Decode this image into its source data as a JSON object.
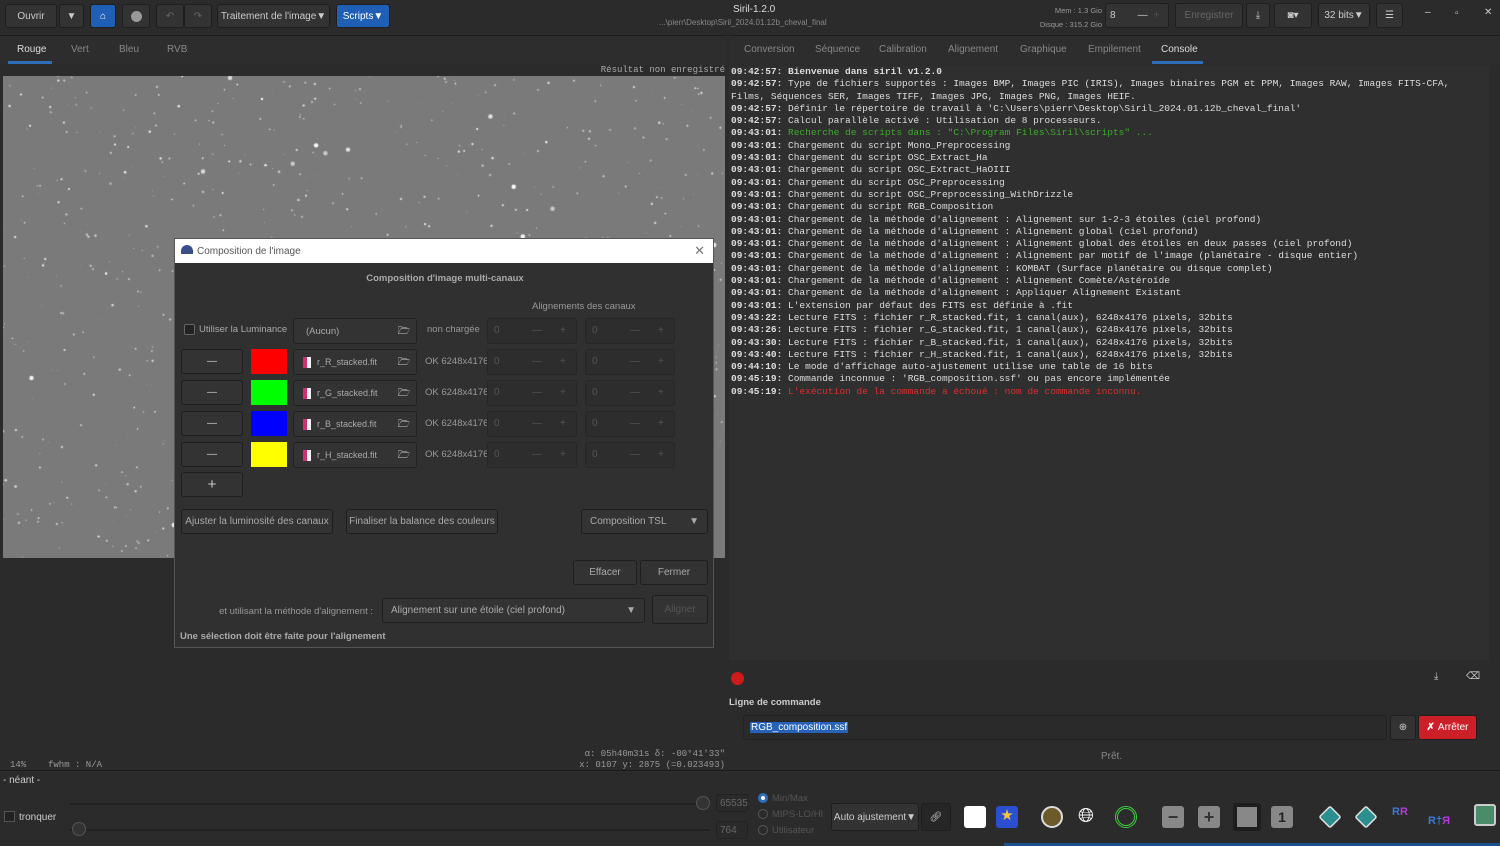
{
  "titlebar": {
    "app_title": "Siril-1.2.0",
    "path": "...\\pierr\\Desktop\\Siril_2024.01.12b_cheval_final",
    "mem": "Mem : 1.3 Gio",
    "disk": "Disque : 315.2 Gio",
    "threads": "8",
    "save": "Enregistrer",
    "bits": "32 bits"
  },
  "toolbar": {
    "open": "Ouvrir",
    "image_processing": "Traitement de l'image",
    "scripts": "Scripts"
  },
  "left_tabs": [
    "Rouge",
    "Vert",
    "Bleu",
    "RVB"
  ],
  "right_tabs": [
    "Conversion",
    "Séquence",
    "Calibration",
    "Alignement",
    "Graphique",
    "Empilement",
    "Console"
  ],
  "image": {
    "unsaved": "Résultat non enregistré",
    "zoom": "14%",
    "fwhm": "fwhm : N/A",
    "coords1": "α: 05h40m31s δ: -00°41'33\"",
    "coords2": "x: 0107 y: 2875 (=0.023493)"
  },
  "console": [
    {
      "t": "09:42:57:",
      "m": "Bienvenue dans siril v1.2.0",
      "c": "bold"
    },
    {
      "t": "09:42:57:",
      "m": "Type de fichiers supportés : Images BMP, Images PIC (IRIS), Images binaires PGM et PPM, Images RAW, Images FITS-CFA, Films, Séquences SER, Images TIFF, Images JPG, Images PNG, Images HEIF.",
      "c": ""
    },
    {
      "t": "09:42:57:",
      "m": "Définir le répertoire de travail à 'C:\\Users\\pierr\\Desktop\\Siril_2024.01.12b_cheval_final'",
      "c": ""
    },
    {
      "t": "09:42:57:",
      "m": "Calcul parallèle activé : Utilisation de 8 processeurs.",
      "c": ""
    },
    {
      "t": "09:43:01:",
      "m": "Recherche de scripts dans : \"C:\\Program Files\\Siril\\scripts\" ...",
      "c": "green"
    },
    {
      "t": "09:43:01:",
      "m": "Chargement du script Mono_Preprocessing",
      "c": ""
    },
    {
      "t": "09:43:01:",
      "m": "Chargement du script OSC_Extract_Ha",
      "c": ""
    },
    {
      "t": "09:43:01:",
      "m": "Chargement du script OSC_Extract_HaOIII",
      "c": ""
    },
    {
      "t": "09:43:01:",
      "m": "Chargement du script OSC_Preprocessing",
      "c": ""
    },
    {
      "t": "09:43:01:",
      "m": "Chargement du script OSC_Preprocessing_WithDrizzle",
      "c": ""
    },
    {
      "t": "09:43:01:",
      "m": "Chargement du script RGB_Composition",
      "c": ""
    },
    {
      "t": "09:43:01:",
      "m": "Chargement de la méthode d'alignement : Alignement sur 1-2-3 étoiles (ciel profond)",
      "c": ""
    },
    {
      "t": "09:43:01:",
      "m": "Chargement de la méthode d'alignement : Alignement global (ciel profond)",
      "c": ""
    },
    {
      "t": "09:43:01:",
      "m": "Chargement de la méthode d'alignement : Alignement global des étoiles en deux passes (ciel profond)",
      "c": ""
    },
    {
      "t": "09:43:01:",
      "m": "Chargement de la méthode d'alignement : Alignement par motif de l'image (planétaire - disque entier)",
      "c": ""
    },
    {
      "t": "09:43:01:",
      "m": "Chargement de la méthode d'alignement : KOMBAT (Surface planétaire ou disque complet)",
      "c": ""
    },
    {
      "t": "09:43:01:",
      "m": "Chargement de la méthode d'alignement : Alignement Comète/Astéroïde",
      "c": ""
    },
    {
      "t": "09:43:01:",
      "m": "Chargement de la méthode d'alignement : Appliquer Alignement Existant",
      "c": ""
    },
    {
      "t": "09:43:01:",
      "m": "L'extension par défaut des FITS est définie à .fit",
      "c": ""
    },
    {
      "t": "09:43:22:",
      "m": "Lecture FITS : fichier r_R_stacked.fit, 1 canal(aux), 6248x4176 pixels, 32bits",
      "c": ""
    },
    {
      "t": "09:43:26:",
      "m": "Lecture FITS : fichier r_G_stacked.fit, 1 canal(aux), 6248x4176 pixels, 32bits",
      "c": ""
    },
    {
      "t": "09:43:30:",
      "m": "Lecture FITS : fichier r_B_stacked.fit, 1 canal(aux), 6248x4176 pixels, 32bits",
      "c": ""
    },
    {
      "t": "09:43:40:",
      "m": "Lecture FITS : fichier r_H_stacked.fit, 1 canal(aux), 6248x4176 pixels, 32bits",
      "c": ""
    },
    {
      "t": "09:44:10:",
      "m": "Le mode d'affichage auto-ajustement utilise une table de 16 bits",
      "c": ""
    },
    {
      "t": "09:45:19:",
      "m": "Commande inconnue : 'RGB_composition.ssf' ou pas encore implémentée",
      "c": ""
    },
    {
      "t": "09:45:19:",
      "m": "L'exécution de la commande a échoué : nom de commande inconnu.",
      "c": "red"
    }
  ],
  "command": {
    "label": "Ligne de commande",
    "value": "RGB_composition.ssf",
    "stop": "Arrêter",
    "status": "Prêt."
  },
  "dialog": {
    "title": "Composition de l'image",
    "heading": "Composition d'image multi-canaux",
    "align_header": "Alignements des canaux",
    "luminance": {
      "label": "Utiliser la Luminance",
      "file": "(Aucun)",
      "status": "non chargée"
    },
    "channels": [
      {
        "color": "#ff0000",
        "file": "r_R_stacked.fit",
        "status": "OK 6248x4176"
      },
      {
        "color": "#00ff00",
        "file": "r_G_stacked.fit",
        "status": "OK 6248x4176"
      },
      {
        "color": "#0000ff",
        "file": "r_B_stacked.fit",
        "status": "OK 6248x4176"
      },
      {
        "color": "#ffff00",
        "file": "r_H_stacked.fit",
        "status": "OK 6248x4176"
      }
    ],
    "spin_value": "0",
    "adjust": "Ajuster la luminosité des canaux",
    "finalize": "Finaliser la balance des couleurs",
    "mode": "Composition TSL",
    "clear": "Effacer",
    "close": "Fermer",
    "method_label": "et utilisant la méthode d'alignement :",
    "method": "Alignement sur une étoile (ciel profond)",
    "align": "Aligner",
    "hint": "Une sélection doit être faite pour l'alignement"
  },
  "bottom": {
    "none": "- néant -",
    "clip": "tronquer",
    "high": "65535",
    "low": "764",
    "radios": [
      "Min/Max",
      "MIPS-LO/HI",
      "Utilisateur"
    ],
    "stretch": "Auto ajustement"
  }
}
